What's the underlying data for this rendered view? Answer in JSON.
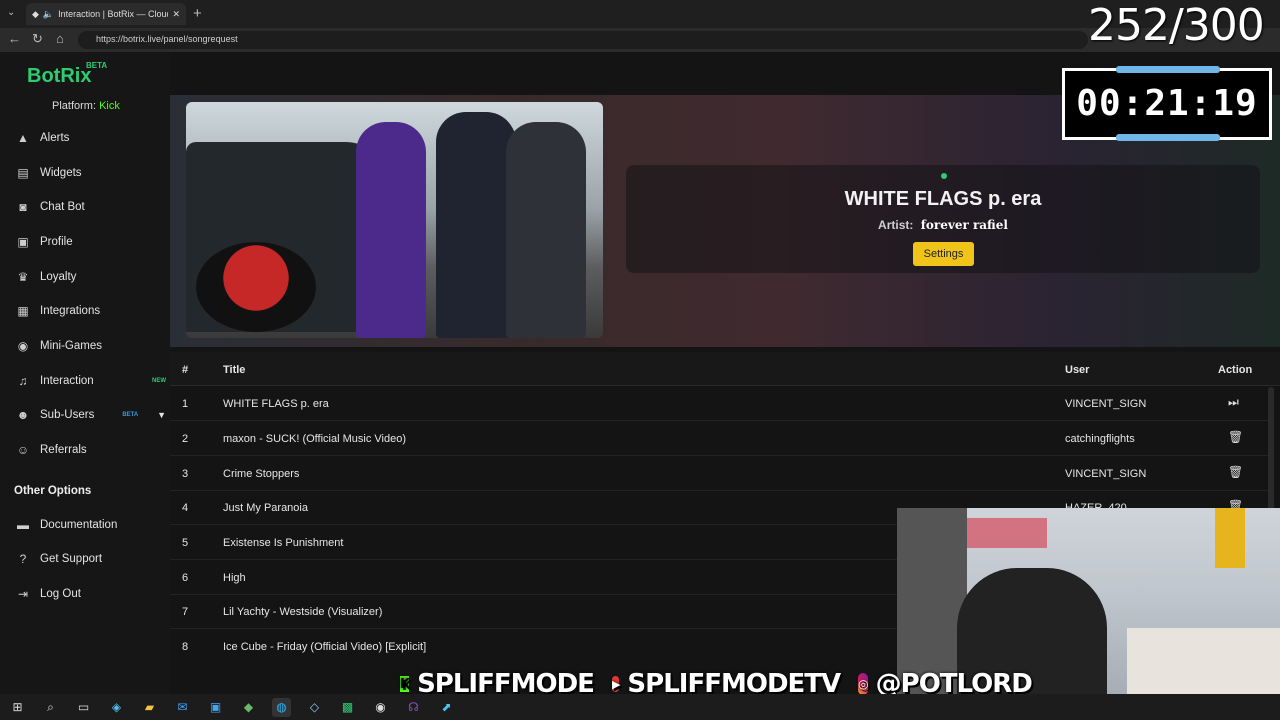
{
  "browser": {
    "tab_title": "Interaction | BotRix — Cloud",
    "url": "https://botrix.live/panel/songrequest"
  },
  "overlay": {
    "counter": "252/300",
    "timer": "00:21:19",
    "socials": {
      "kick": "SPLIFFMODE",
      "youtube": "SPLIFFMODETV",
      "instagram": "@POTLORD"
    }
  },
  "sidebar": {
    "logo": "BotRix",
    "logo_badge": "BETA",
    "platform_label": "Platform:",
    "platform_value": "Kick",
    "items": [
      {
        "label": "Alerts",
        "icon": "warning-icon"
      },
      {
        "label": "Widgets",
        "icon": "list-icon"
      },
      {
        "label": "Chat Bot",
        "icon": "robot-icon"
      },
      {
        "label": "Profile",
        "icon": "id-card-icon"
      },
      {
        "label": "Loyalty",
        "icon": "trophy-icon"
      },
      {
        "label": "Integrations",
        "icon": "integrations-icon"
      },
      {
        "label": "Mini-Games",
        "icon": "gamepad-icon"
      },
      {
        "label": "Interaction",
        "icon": "music-icon",
        "badge": "NEW"
      },
      {
        "label": "Sub-Users",
        "icon": "users-icon",
        "badge": "BETA"
      },
      {
        "label": "Referrals",
        "icon": "referrals-icon"
      }
    ],
    "other_heading": "Other Options",
    "other_items": [
      {
        "label": "Documentation",
        "icon": "book-icon"
      },
      {
        "label": "Get Support",
        "icon": "question-icon"
      },
      {
        "label": "Log Out",
        "icon": "logout-icon"
      }
    ],
    "colors": {
      "accent": "#2ecc71",
      "kick": "#53fc18",
      "new_badge": "#2ecc71",
      "beta_badge": "#3498db"
    }
  },
  "now_playing": {
    "title": "WHITE FLAGS p. era",
    "artist_label": "Artist:",
    "artist": "forever rafiel",
    "settings_label": "Settings"
  },
  "queue": {
    "headers": {
      "num": "#",
      "title": "Title",
      "user": "User",
      "action": "Action"
    },
    "rows": [
      {
        "num": "1",
        "title": "WHITE FLAGS p. era",
        "user": "VINCENT_SIGN",
        "action": "skip-icon"
      },
      {
        "num": "2",
        "title": "maxon - SUCK! (Official Music Video)",
        "user": "catchingflights",
        "action": "trash-icon"
      },
      {
        "num": "3",
        "title": "Crime Stoppers",
        "user": "VINCENT_SIGN",
        "action": "trash-icon"
      },
      {
        "num": "4",
        "title": "Just My Paranoia",
        "user": "HAZER_420",
        "action": "trash-icon"
      },
      {
        "num": "5",
        "title": "Existense Is Punishment",
        "user": "",
        "action": ""
      },
      {
        "num": "6",
        "title": "High",
        "user": "",
        "action": ""
      },
      {
        "num": "7",
        "title": "Lil Yachty - Westside (Visualizer)",
        "user": "",
        "action": ""
      },
      {
        "num": "8",
        "title": "Ice Cube - Friday (Official Video) [Explicit]",
        "user": "",
        "action": ""
      }
    ]
  }
}
